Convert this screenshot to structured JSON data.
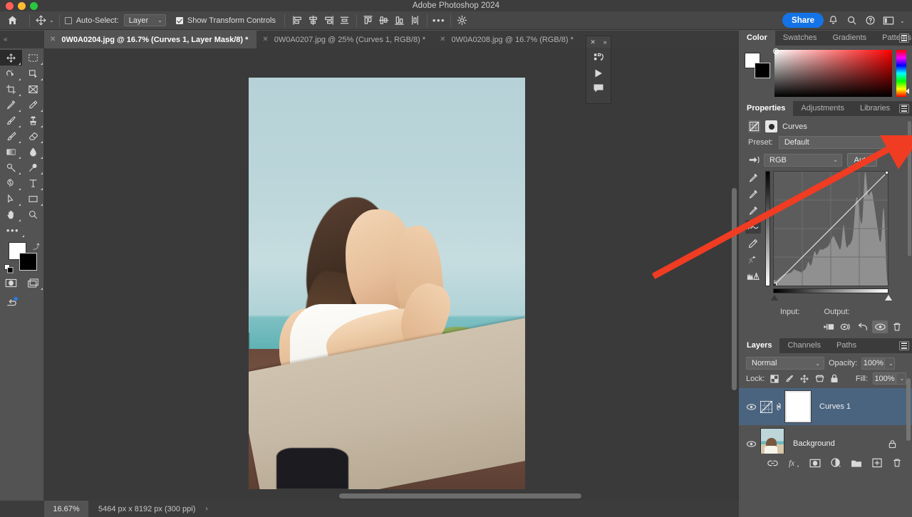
{
  "window": {
    "title": "Adobe Photoshop 2024"
  },
  "options_bar": {
    "home_icon": "home-icon",
    "move_tool_icon": "move-tool-icon",
    "auto_select_label": "Auto-Select:",
    "auto_select_checked": false,
    "auto_select_target": "Layer",
    "show_transform_label": "Show Transform Controls",
    "show_transform_checked": true,
    "align_icons": [
      "align-left-edges",
      "align-horizontal-centers",
      "align-right-edges",
      "distribute-horizontally",
      "align-top-edges",
      "align-vertical-centers",
      "align-bottom-edges",
      "distribute-vertically"
    ],
    "more_label": "•••",
    "settings_icon": "gear-icon",
    "share_label": "Share",
    "header_icons": [
      "bell-icon",
      "search-icon",
      "help-icon",
      "workspace-icon",
      "chevron-down-icon"
    ]
  },
  "tabs": {
    "collapse_label": "«",
    "items": [
      {
        "title": "0W0A0204.jpg @ 16.7% (Curves 1, Layer Mask/8) *",
        "active": true
      },
      {
        "title": "0W0A0207.jpg @ 25% (Curves 1, RGB/8) *",
        "active": false
      },
      {
        "title": "0W0A0208.jpg @ 16.7% (RGB/8) *",
        "active": false
      }
    ]
  },
  "toolbar": {
    "tools": [
      {
        "name": "move-tool",
        "selected": true
      },
      {
        "name": "rectangular-marquee-tool",
        "selected": false
      },
      {
        "name": "object-selection-tool",
        "selected": false
      },
      {
        "name": "lasso-tool",
        "selected": false
      },
      {
        "name": "crop-tool",
        "selected": false
      },
      {
        "name": "frame-tool",
        "selected": false
      },
      {
        "name": "eyedropper-tool",
        "selected": false
      },
      {
        "name": "spot-healing-brush-tool",
        "selected": false
      },
      {
        "name": "brush-tool",
        "selected": false
      },
      {
        "name": "clone-stamp-tool",
        "selected": false
      },
      {
        "name": "history-brush-tool",
        "selected": false
      },
      {
        "name": "eraser-tool",
        "selected": false
      },
      {
        "name": "gradient-tool",
        "selected": false
      },
      {
        "name": "blur-tool",
        "selected": false
      },
      {
        "name": "dodge-tool",
        "selected": false
      },
      {
        "name": "pen-tool",
        "selected": false
      },
      {
        "name": "horizontal-type-tool",
        "selected": false
      },
      {
        "name": "path-selection-tool",
        "selected": false
      },
      {
        "name": "rectangle-tool",
        "selected": false
      },
      {
        "name": "hand-tool",
        "selected": false
      },
      {
        "name": "zoom-tool",
        "selected": false
      },
      {
        "name": "edit-toolbar-tool",
        "selected": false
      }
    ],
    "foreground_color": "#ffffff",
    "background_color": "#000000",
    "quick_mask_icon": "quick-mask-icon",
    "screen_mode_icon": "screen-mode-icon",
    "discover_icon": "discover-icon"
  },
  "floating_panel": {
    "close_label": "✕",
    "expand_label": "»",
    "buttons": [
      "new-action-icon",
      "play-icon",
      "comment-icon"
    ]
  },
  "color_panel": {
    "tabs": [
      "Color",
      "Swatches",
      "Gradients",
      "Patterns"
    ],
    "active_tab": "Color",
    "foreground": "#ffffff",
    "background": "#000000",
    "hue": "#ff0000",
    "menu_icon": "panel-menu-icon"
  },
  "properties_panel": {
    "tabs": [
      "Properties",
      "Adjustments",
      "Libraries"
    ],
    "active_tab": "Properties",
    "menu_icon": "panel-menu-icon",
    "adjustment_title": "Curves",
    "preset_label": "Preset:",
    "preset_value": "Default",
    "channel_value": "RGB",
    "auto_label": "Auto",
    "input_label": "Input:",
    "output_label": "Output:",
    "curve_tools": [
      "on-image-adjust-icon",
      "black-point-eyedropper",
      "gray-point-eyedropper",
      "white-point-eyedropper",
      "curve-point-tool",
      "pencil-tool",
      "smooth-curve-icon",
      "clipping-warning-icon"
    ],
    "selected_curve_tool": "curve-point-tool",
    "footer_icons": [
      "clip-to-layer-icon",
      "view-previous-state-icon",
      "reset-icon",
      "toggle-visibility-icon",
      "delete-icon"
    ]
  },
  "layers_panel": {
    "tabs": [
      "Layers",
      "Channels",
      "Paths"
    ],
    "active_tab": "Layers",
    "menu_icon": "panel-menu-icon",
    "blend_mode": "Normal",
    "opacity_label": "Opacity:",
    "opacity_value": "100%",
    "lock_label": "Lock:",
    "lock_icons": [
      "lock-transparent-pixels",
      "lock-image-pixels",
      "lock-position",
      "lock-artboard-nesting",
      "lock-all"
    ],
    "fill_label": "Fill:",
    "fill_value": "100%",
    "layers": [
      {
        "name": "Curves 1",
        "selected": true,
        "visible": true,
        "kind": "adjustment",
        "locked": false
      },
      {
        "name": "Background",
        "selected": false,
        "visible": true,
        "kind": "image",
        "locked": true
      }
    ],
    "footer_icons": [
      "link-layers-icon",
      "layer-style-icon",
      "layer-mask-icon",
      "new-adjustment-layer-icon",
      "new-group-icon",
      "new-layer-icon",
      "delete-layer-icon"
    ]
  },
  "status_bar": {
    "zoom": "16.67%",
    "doc_info": "5464 px x 8192 px (300 ppi)",
    "expand_arrow": "›"
  },
  "annotation": {
    "arrow_color": "#f03c22",
    "points_to": "properties-panel-menu-icon"
  },
  "chart_data": {
    "type": "line",
    "title": "Curves RGB",
    "xlabel": "Input",
    "ylabel": "Output",
    "xlim": [
      0,
      255
    ],
    "ylim": [
      0,
      255
    ],
    "grid": true,
    "curve_points": [
      [
        0,
        0
      ],
      [
        255,
        255
      ]
    ],
    "histogram": [
      6,
      6,
      6,
      6,
      5,
      5,
      5,
      6,
      6,
      6,
      7,
      7,
      8,
      8,
      8,
      9,
      9,
      9,
      10,
      10,
      10,
      11,
      11,
      11,
      12,
      12,
      12,
      12,
      12,
      12,
      12,
      12,
      12,
      13,
      13,
      13,
      13,
      13,
      13,
      13,
      14,
      14,
      14,
      15,
      15,
      16,
      16,
      17,
      17,
      17,
      17,
      16,
      16,
      16,
      16,
      16,
      15,
      15,
      15,
      15,
      15,
      15,
      14,
      14,
      14,
      14,
      15,
      15,
      15,
      15,
      16,
      16,
      16,
      17,
      17,
      18,
      19,
      20,
      21,
      23,
      24,
      25,
      25,
      24,
      23,
      22,
      21,
      21,
      22,
      23,
      25,
      27,
      29,
      31,
      33,
      35,
      36,
      36,
      35,
      34,
      33,
      32,
      32,
      33,
      34,
      35,
      36,
      37,
      38,
      38,
      38,
      38,
      38,
      38,
      38,
      38,
      38,
      38,
      39,
      39,
      39,
      39,
      40,
      40,
      40,
      40,
      41,
      41,
      42,
      42,
      43,
      44,
      45,
      46,
      47,
      48,
      49,
      50,
      51,
      52,
      52,
      52,
      51,
      50,
      49,
      48,
      47,
      46,
      45,
      44,
      43,
      42,
      41,
      40,
      39,
      38,
      38,
      39,
      41,
      44,
      48,
      53,
      58,
      62,
      64,
      63,
      60,
      55,
      50,
      46,
      43,
      41,
      40,
      40,
      41,
      42,
      43,
      43,
      43,
      43,
      44,
      45,
      46,
      47,
      48,
      50,
      53,
      57,
      62,
      68,
      74,
      80,
      86,
      90,
      92,
      93,
      93,
      92,
      90,
      87,
      83,
      79,
      75,
      71,
      68,
      66,
      65,
      66,
      69,
      74,
      82,
      92,
      103,
      112,
      118,
      120,
      119,
      115,
      110,
      105,
      101,
      98,
      96,
      95,
      95,
      96,
      97,
      98,
      99,
      99,
      99,
      98,
      96,
      94,
      91,
      88,
      85,
      82,
      79,
      76,
      73,
      70,
      67,
      64,
      61,
      58,
      55,
      52,
      49,
      47,
      46,
      46,
      48,
      52,
      58,
      66,
      74,
      80,
      82,
      79,
      72,
      62,
      50,
      38,
      26,
      16,
      9,
      5,
      3
    ]
  }
}
